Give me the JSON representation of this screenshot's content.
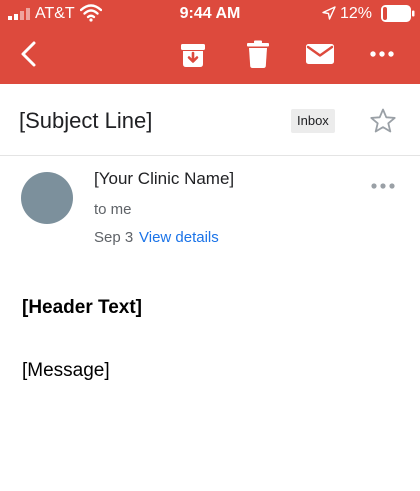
{
  "status_bar": {
    "carrier": "AT&T",
    "time": "9:44 AM",
    "battery": "12%",
    "battery_level": 0.12,
    "icons": [
      "signal-icon",
      "wifi-icon",
      "location-arrow-icon",
      "battery-icon"
    ]
  },
  "toolbar": {
    "icons": [
      "back-arrow-icon",
      "archive-icon",
      "trash-icon",
      "mail-icon",
      "more-icon"
    ],
    "color": "#dd4a3d"
  },
  "email": {
    "subject": "[Subject Line]",
    "label": "Inbox",
    "sender": "[Your Clinic Name]",
    "recipient": "to me",
    "date": "Sep 3",
    "view_details": "View details",
    "header_text": "[Header Text]",
    "message": "[Message]"
  },
  "colors": {
    "accent": "#dd4a3d",
    "link": "#1a73e8",
    "avatar": "#7c909c",
    "battery_low": "#dd4a3d"
  }
}
